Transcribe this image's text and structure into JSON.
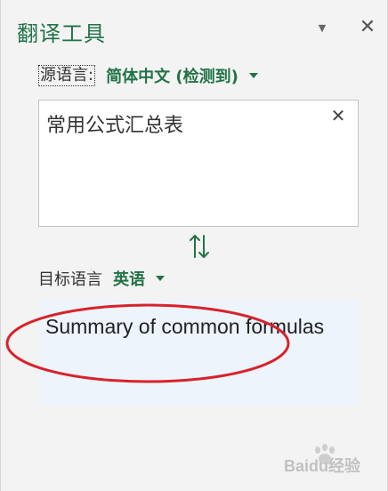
{
  "pane": {
    "title": "翻译工具",
    "menu_icon": "chevron-down-icon",
    "close_icon": "close-icon",
    "close_glyph": "✕"
  },
  "source": {
    "label": "源语言:",
    "language": "简体中文 (检测到)",
    "text": "常用公式汇总表",
    "clear_glyph": "✕"
  },
  "swap_icon": "swap-arrows-icon",
  "target": {
    "label": "目标语言",
    "language": "英语",
    "text": "Summary of common formulas"
  },
  "watermark": {
    "text": "Baidu经验"
  },
  "colors": {
    "accent": "#217346",
    "annotation": "#d9222a",
    "target_bg": "#eef4fc"
  }
}
